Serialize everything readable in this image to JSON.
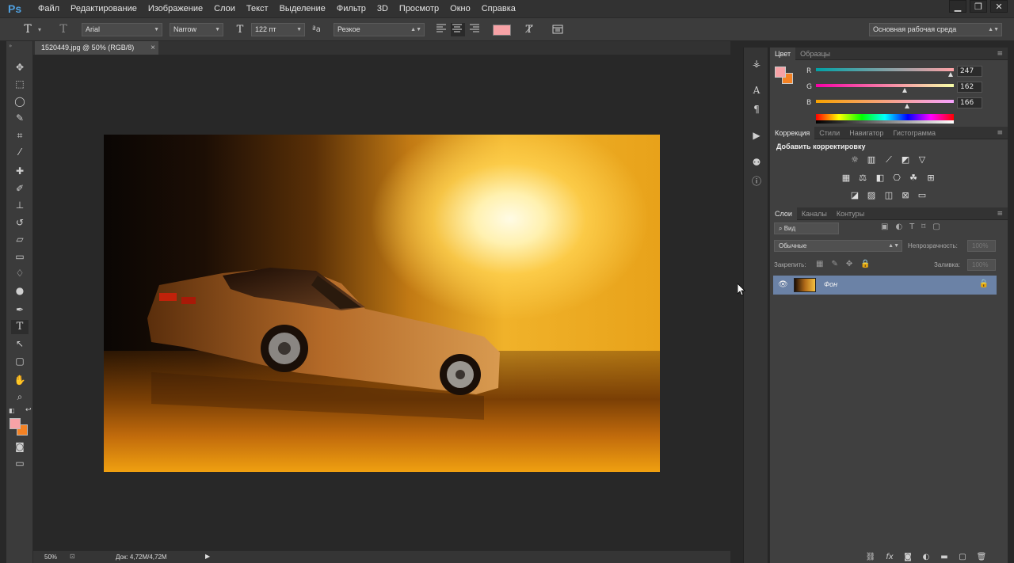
{
  "app": {
    "logo": "Ps"
  },
  "menu": [
    "Файл",
    "Редактирование",
    "Изображение",
    "Слои",
    "Текст",
    "Выделение",
    "Фильтр",
    "3D",
    "Просмотр",
    "Окно",
    "Справка"
  ],
  "window_controls": {
    "minimize": "▁",
    "restore": "❐",
    "close": "✕"
  },
  "options": {
    "font_family": "Arial",
    "font_style": "Narrow",
    "font_size": "122 пт",
    "aa_label": "ªa",
    "antialias": "Резкое",
    "text_color": "#f7a2a6",
    "workspace": "Основная рабочая среда"
  },
  "document": {
    "tab_title": "1520449.jpg @ 50% (RGB/8)",
    "close": "×",
    "zoom": "50%",
    "doc_size": "Док: 4,72M/4,72M"
  },
  "colors": {
    "foreground": "#f7a2a6",
    "background": "#f48224"
  },
  "color_panel": {
    "tabs": [
      "Цвет",
      "Образцы"
    ],
    "sliders": [
      {
        "label": "R",
        "value": "247"
      },
      {
        "label": "G",
        "value": "162"
      },
      {
        "label": "B",
        "value": "166"
      }
    ]
  },
  "adjust_panel": {
    "tabs": [
      "Коррекция",
      "Стили",
      "Навигатор",
      "Гистограмма"
    ],
    "heading": "Добавить корректировку"
  },
  "layers_panel": {
    "tabs": [
      "Слои",
      "Каналы",
      "Контуры"
    ],
    "filter_label": "⌕ Вид",
    "blend_mode": "Обычные",
    "opacity_label": "Непрозрачность:",
    "opacity_value": "100%",
    "lock_label": "Закрепить:",
    "fill_label": "Заливка:",
    "fill_value": "100%",
    "layers": [
      {
        "name": "Фон",
        "visible": true,
        "locked": true
      }
    ]
  }
}
